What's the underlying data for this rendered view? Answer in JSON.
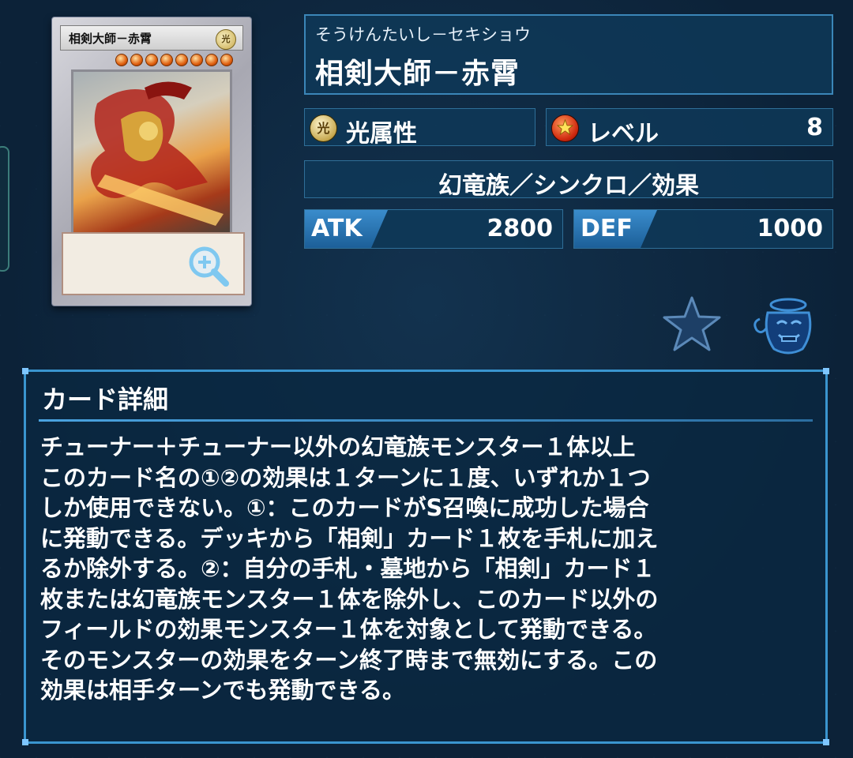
{
  "card": {
    "reading": "そうけんたいし－セキショウ",
    "name": "相剣大師－赤霄",
    "attribute_label": "光属性",
    "attribute_glyph": "光",
    "level_label": "レベル",
    "level_value": "8",
    "type_line": "幻竜族／シンクロ／効果",
    "atk_label": "ATK",
    "atk_value": "2800",
    "def_label": "DEF",
    "def_value": "1000"
  },
  "card_image": {
    "name_text": "相剣大師－赤霄",
    "attribute_glyph": "光",
    "stars": 8
  },
  "detail": {
    "title": "カード詳細",
    "lines": [
      "チューナー＋チューナー以外の幻竜族モンスター１体以上",
      "このカード名の①②の効果は１ターンに１度、いずれか１つ",
      "しか使用できない。①：このカードがS召喚に成功した場合",
      "に発動できる。デッキから「相剣」カード１枚を手札に加え",
      "るか除外する。②：自分の手札・墓地から「相剣」カード１",
      "枚または幻竜族モンスター１体を除外し、このカード以外の",
      "フィールドの効果モンスター１体を対象として発動できる。",
      "そのモンスターの効果をターン終了時まで無効にする。この",
      "効果は相手ターンでも発動できる。"
    ]
  },
  "icons": {
    "favorite": "star-icon",
    "vase": "vase-icon",
    "zoom": "zoom-in-icon"
  }
}
